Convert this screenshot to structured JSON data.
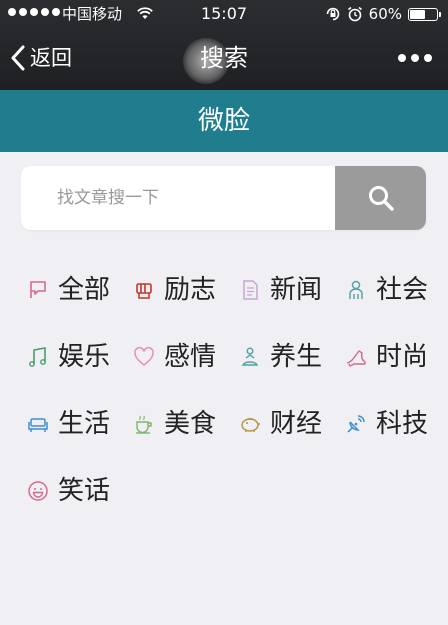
{
  "status_bar": {
    "carrier": "中国移动",
    "time": "15:07",
    "battery_percent": "60%",
    "battery_level": 0.6,
    "icons": [
      "signal-dots",
      "wifi-icon",
      "rotation-lock-icon",
      "alarm-icon",
      "battery-icon"
    ]
  },
  "nav": {
    "back_label": "返回",
    "title": "搜索",
    "back_icon": "chevron-left-icon",
    "more_icon": "more-dots-icon"
  },
  "brand": {
    "title": "微脸"
  },
  "search": {
    "placeholder": "找文章搜一下",
    "value": "",
    "button_icon": "search-icon"
  },
  "categories": [
    {
      "label": "全部",
      "icon": "flag-icon",
      "color": "#d46a8e"
    },
    {
      "label": "励志",
      "icon": "fist-icon",
      "color": "#c0392b"
    },
    {
      "label": "新闻",
      "icon": "document-icon",
      "color": "#c9a4d4"
    },
    {
      "label": "社会",
      "icon": "person-icon",
      "color": "#5ba3a0"
    },
    {
      "label": "娱乐",
      "icon": "music-note-icon",
      "color": "#4a9e6b"
    },
    {
      "label": "感情",
      "icon": "heart-icon",
      "color": "#e58fb0"
    },
    {
      "label": "养生",
      "icon": "meditation-icon",
      "color": "#4fa3a0"
    },
    {
      "label": "时尚",
      "icon": "high-heel-icon",
      "color": "#d46a8e"
    },
    {
      "label": "生活",
      "icon": "sofa-icon",
      "color": "#3d8fd1"
    },
    {
      "label": "美食",
      "icon": "cup-icon",
      "color": "#7db56a"
    },
    {
      "label": "财经",
      "icon": "piggy-bank-icon",
      "color": "#b3903d"
    },
    {
      "label": "科技",
      "icon": "satellite-icon",
      "color": "#3d8fd1"
    },
    {
      "label": "笑话",
      "icon": "smile-icon",
      "color": "#d46a8e"
    }
  ],
  "colors": {
    "topbar": "#1f2024",
    "brand_bar": "#1f7d8e",
    "background": "#efeff4",
    "search_button": "#9b9b9b"
  }
}
